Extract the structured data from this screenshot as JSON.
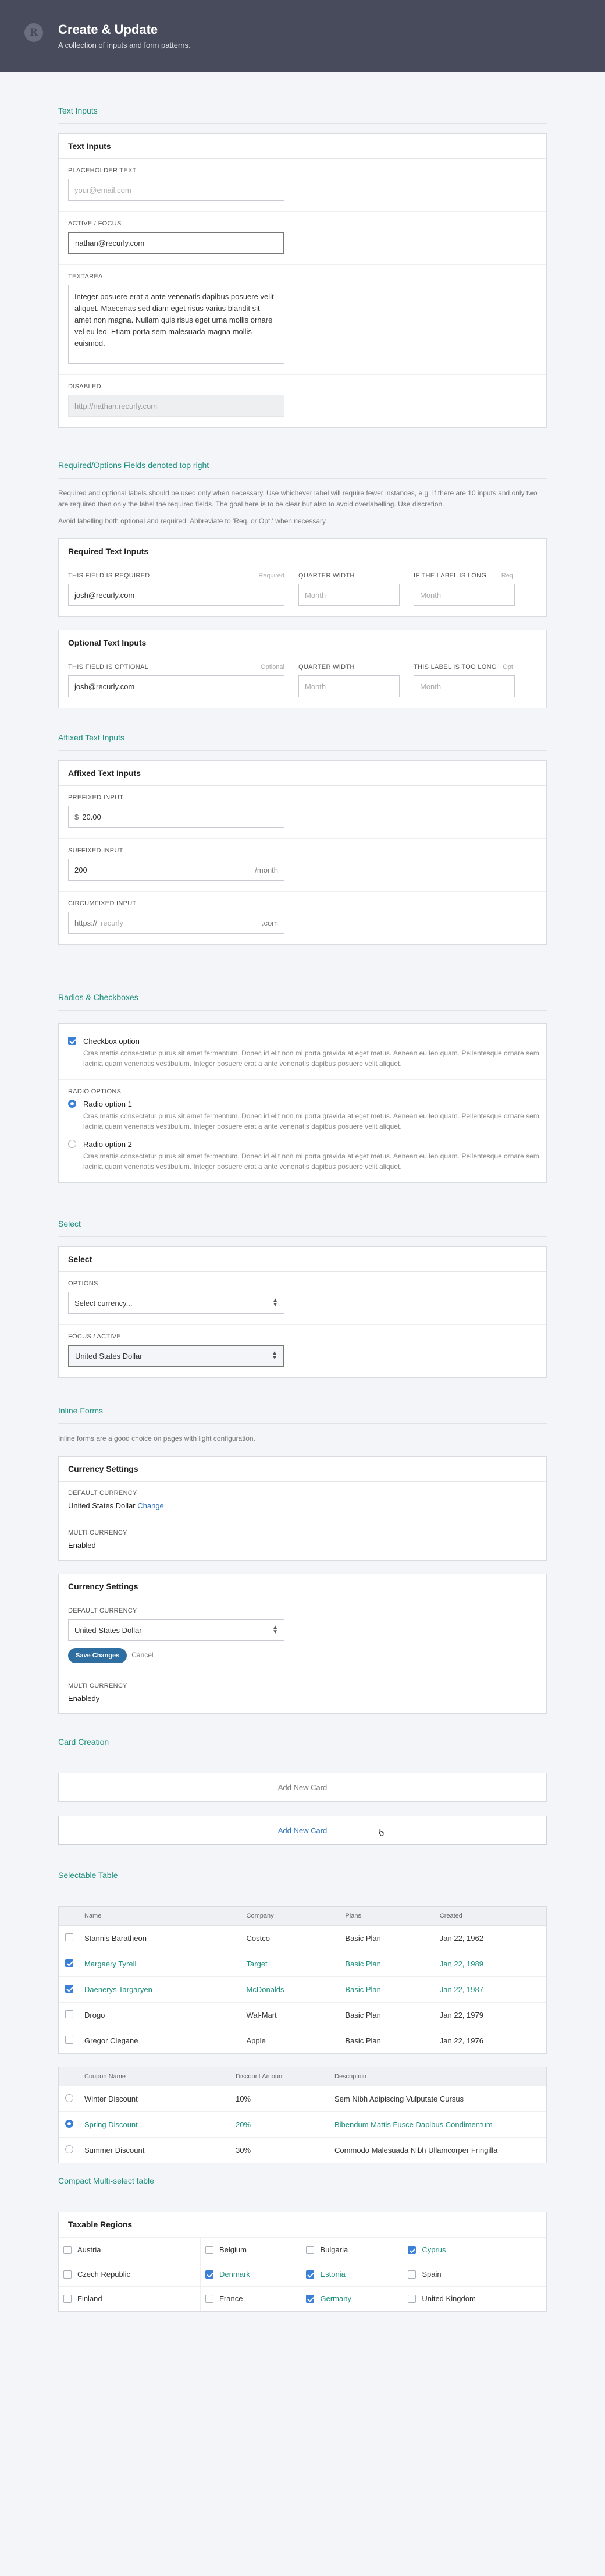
{
  "header": {
    "logo_letter": "R",
    "title": "Create & Update",
    "subtitle": "A collection of inputs and form patterns."
  },
  "text_inputs": {
    "section": "Text Inputs",
    "card_title": "Text Inputs",
    "placeholder": {
      "label": "Placeholder Text",
      "placeholder": "your@email.com"
    },
    "active": {
      "label": "Active / Focus",
      "value": "nathan@recurly.com"
    },
    "textarea": {
      "label": "Textarea",
      "value": "Integer posuere erat a ante venenatis dapibus posuere velit aliquet. Maecenas sed diam eget risus varius blandit sit amet non magna. Nullam quis risus eget urna mollis ornare vel eu leo. Etiam porta sem malesuada magna mollis euismod."
    },
    "disabled": {
      "label": "Disabled",
      "value": "http://nathan.recurly.com"
    }
  },
  "required": {
    "section": "Required/Options Fields denoted top right",
    "note1": "Required and optional labels should be used only when necessary. Use whichever label will require fewer instances, e.g. If there are 10 inputs and only two are required then only the label the required fields. The goal here is to be clear but also to avoid overlabelling. Use discretion.",
    "note2": "Avoid labelling both optional and required. Abbreviate to 'Req. or Opt.' when necessary.",
    "req_card": {
      "title": "Required Text Inputs",
      "f1_label": "This field is required",
      "f1_tag": "Required",
      "f1_value": "josh@recurly.com",
      "f2_label": "Quarter width",
      "f2_placeholder": "Month",
      "f3_label": "If the label is long",
      "f3_tag": "Req.",
      "f3_placeholder": "Month"
    },
    "opt_card": {
      "title": "Optional Text Inputs",
      "f1_label": "This field is optional",
      "f1_tag": "Optional",
      "f1_value": "josh@recurly.com",
      "f2_label": "Quarter width",
      "f2_placeholder": "Month",
      "f3_label": "This label is too long",
      "f3_tag": "Opt.",
      "f3_placeholder": "Month"
    }
  },
  "affixed": {
    "section": "Affixed Text Inputs",
    "card_title": "Affixed Text Inputs",
    "prefixed": {
      "label": "Prefixed Input",
      "prefix": "$",
      "value": "20.00"
    },
    "suffixed": {
      "label": "Suffixed Input",
      "value": "200",
      "suffix": "/month"
    },
    "circumfixed": {
      "label": "Circumfixed Input",
      "prefix": "https://",
      "placeholder": "recurly",
      "suffix": ".com"
    }
  },
  "radios": {
    "section": "Radios & Checkboxes",
    "checkbox": {
      "label": "Checkbox option",
      "desc": "Cras mattis consectetur purus sit amet fermentum. Donec id elit non mi porta gravida at eget metus. Aenean eu leo quam. Pellentesque ornare sem lacinia quam venenatis vestibulum. Integer posuere erat a ante venenatis dapibus posuere velit aliquet."
    },
    "radio_group_label": "Radio options",
    "radio1": {
      "label": "Radio option 1",
      "desc": "Cras mattis consectetur purus sit amet fermentum. Donec id elit non mi porta gravida at eget metus. Aenean eu leo quam. Pellentesque ornare sem lacinia quam venenatis vestibulum. Integer posuere erat a ante venenatis dapibus posuere velit aliquet."
    },
    "radio2": {
      "label": "Radio option 2",
      "desc": "Cras mattis consectetur purus sit amet fermentum. Donec id elit non mi porta gravida at eget metus. Aenean eu leo quam. Pellentesque ornare sem lacinia quam venenatis vestibulum. Integer posuere erat a ante venenatis dapibus posuere velit aliquet."
    }
  },
  "select": {
    "section": "Select",
    "card_title": "Select",
    "options": {
      "label": "Options",
      "value": "Select currency..."
    },
    "focus": {
      "label": "Focus / Active",
      "value": "United States Dollar"
    }
  },
  "inline": {
    "section": "Inline Forms",
    "note": "Inline forms are a good choice on pages with light configuration.",
    "card1": {
      "title": "Currency Settings",
      "dc_label": "Default Currency",
      "dc_value": "United States Dollar",
      "change": "Change",
      "mc_label": "Multi Currency",
      "mc_value": "Enabled"
    },
    "card2": {
      "title": "Currency Settings",
      "dc_label": "Default Currency",
      "dc_value": "United States Dollar",
      "save": "Save Changes",
      "cancel": "Cancel",
      "mc_label": "Multi Currency",
      "mc_value": "Enabledy"
    }
  },
  "card_creation": {
    "section": "Card Creation",
    "add1": "Add New Card",
    "add2": "Add New Card"
  },
  "selectable": {
    "section": "Selectable Table",
    "t1": {
      "headers": [
        "Name",
        "Company",
        "Plans",
        "Created"
      ],
      "rows": [
        {
          "checked": false,
          "cells": [
            "Stannis Baratheon",
            "Costco",
            "Basic Plan",
            "Jan 22, 1962"
          ]
        },
        {
          "checked": true,
          "cells": [
            "Margaery Tyrell",
            "Target",
            "Basic Plan",
            "Jan 22, 1989"
          ]
        },
        {
          "checked": true,
          "cells": [
            "Daenerys Targaryen",
            "McDonalds",
            "Basic Plan",
            "Jan 22, 1987"
          ]
        },
        {
          "checked": false,
          "cells": [
            "Drogo",
            "Wal-Mart",
            "Basic Plan",
            "Jan 22, 1979"
          ]
        },
        {
          "checked": false,
          "cells": [
            "Gregor Clegane",
            "Apple",
            "Basic Plan",
            "Jan 22, 1976"
          ]
        }
      ]
    },
    "t2": {
      "headers": [
        "Coupon Name",
        "Discount Amount",
        "Description"
      ],
      "rows": [
        {
          "checked": false,
          "cells": [
            "Winter Discount",
            "10%",
            "Sem Nibh Adipiscing Vulputate Cursus"
          ]
        },
        {
          "checked": true,
          "cells": [
            "Spring Discount",
            "20%",
            "Bibendum Mattis Fusce Dapibus Condimentum"
          ]
        },
        {
          "checked": false,
          "cells": [
            "Summer Discount",
            "30%",
            "Commodo Malesuada Nibh Ullamcorper Fringilla"
          ]
        }
      ]
    }
  },
  "compact": {
    "section": "Compact Multi-select table",
    "card_title": "Taxable Regions",
    "rows": [
      [
        {
          "label": "Austria",
          "checked": false
        },
        {
          "label": "Belgium",
          "checked": false
        },
        {
          "label": "Bulgaria",
          "checked": false
        },
        {
          "label": "Cyprus",
          "checked": true
        }
      ],
      [
        {
          "label": "Czech Republic",
          "checked": false
        },
        {
          "label": "Denmark",
          "checked": true
        },
        {
          "label": "Estonia",
          "checked": true
        },
        {
          "label": "Spain",
          "checked": false
        }
      ],
      [
        {
          "label": "Finland",
          "checked": false
        },
        {
          "label": "France",
          "checked": false
        },
        {
          "label": "Germany",
          "checked": true
        },
        {
          "label": "United Kingdom",
          "checked": false
        }
      ]
    ]
  }
}
